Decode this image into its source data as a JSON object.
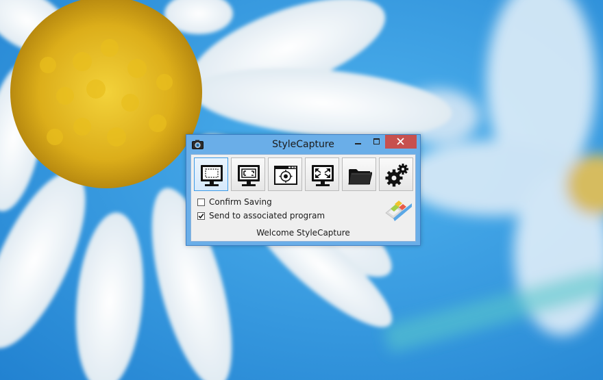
{
  "window": {
    "title": "StyleCapture"
  },
  "toolbar": {
    "tools": [
      {
        "icon": "capture-region-icon"
      },
      {
        "icon": "capture-fullscreen-icon"
      },
      {
        "icon": "capture-window-icon"
      },
      {
        "icon": "capture-expand-icon"
      },
      {
        "icon": "open-folder-icon"
      },
      {
        "icon": "settings-gears-icon"
      }
    ]
  },
  "options": {
    "confirm_saving": {
      "label": "Confirm Saving",
      "checked": false
    },
    "send_to_program": {
      "label": "Send to associated program",
      "checked": true
    }
  },
  "status": {
    "text": "Welcome StyleCapture"
  },
  "colors": {
    "titlebar": "#6aaee8",
    "close_button": "#c7504e",
    "active_tool_border": "#3c9ae6"
  }
}
